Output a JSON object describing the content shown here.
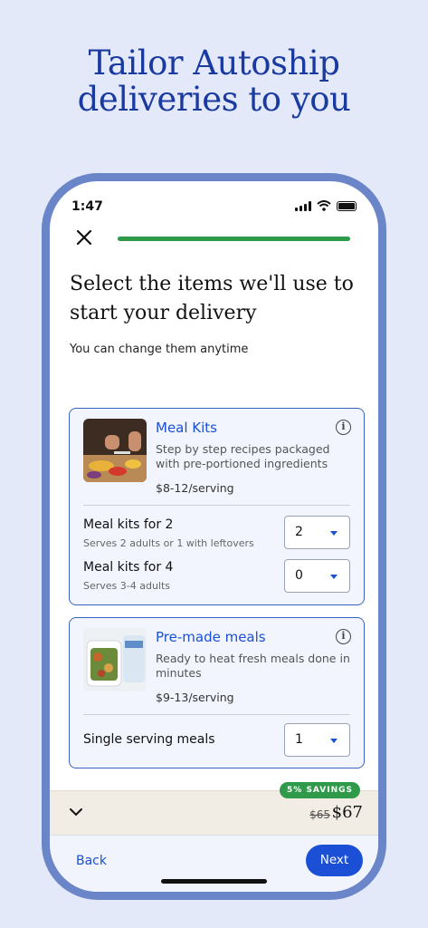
{
  "headline": {
    "line1": "Tailor Autoship",
    "line2": "deliveries to you"
  },
  "status_bar": {
    "time": "1:47"
  },
  "progress": {
    "fraction": 1.0,
    "color": "#2e9a4a"
  },
  "page": {
    "title": "Select the items we'll use to start your delivery",
    "subtitle": "You can change them anytime"
  },
  "cards": [
    {
      "title": "Meal Kits",
      "description": "Step by step recipes packaged with pre-portioned ingredients",
      "price": "$8-12/serving",
      "options": [
        {
          "label": "Meal kits for 2",
          "sublabel": "Serves 2 adults or 1 with leftovers",
          "value": "2"
        },
        {
          "label": "Meal kits for 4",
          "sublabel": "Serves 3-4 adults",
          "value": "0"
        }
      ]
    },
    {
      "title": "Pre-made meals",
      "description": "Ready to heat fresh meals done in minutes",
      "price": "$9-13/serving",
      "options": [
        {
          "label": "Single serving meals",
          "value": "1"
        }
      ]
    }
  ],
  "summary": {
    "savings_badge": "5% SAVINGS",
    "old_price": "$65",
    "new_price": "$67"
  },
  "footer": {
    "back_label": "Back",
    "next_label": "Next"
  },
  "colors": {
    "accent": "#1a4fd6",
    "frame": "#6a86c9",
    "background": "#e3e9f9",
    "savings": "#2e9a4a"
  }
}
